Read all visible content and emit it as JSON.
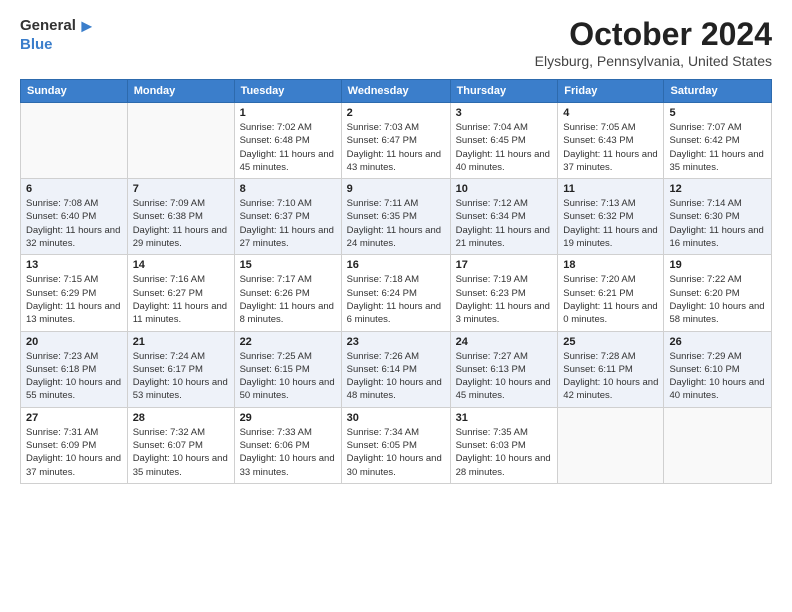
{
  "header": {
    "logo_general": "General",
    "logo_blue": "Blue",
    "month_title": "October 2024",
    "location": "Elysburg, Pennsylvania, United States"
  },
  "columns": [
    "Sunday",
    "Monday",
    "Tuesday",
    "Wednesday",
    "Thursday",
    "Friday",
    "Saturday"
  ],
  "weeks": [
    [
      {
        "day": "",
        "sunrise": "",
        "sunset": "",
        "daylight": ""
      },
      {
        "day": "",
        "sunrise": "",
        "sunset": "",
        "daylight": ""
      },
      {
        "day": "1",
        "sunrise": "Sunrise: 7:02 AM",
        "sunset": "Sunset: 6:48 PM",
        "daylight": "Daylight: 11 hours and 45 minutes."
      },
      {
        "day": "2",
        "sunrise": "Sunrise: 7:03 AM",
        "sunset": "Sunset: 6:47 PM",
        "daylight": "Daylight: 11 hours and 43 minutes."
      },
      {
        "day": "3",
        "sunrise": "Sunrise: 7:04 AM",
        "sunset": "Sunset: 6:45 PM",
        "daylight": "Daylight: 11 hours and 40 minutes."
      },
      {
        "day": "4",
        "sunrise": "Sunrise: 7:05 AM",
        "sunset": "Sunset: 6:43 PM",
        "daylight": "Daylight: 11 hours and 37 minutes."
      },
      {
        "day": "5",
        "sunrise": "Sunrise: 7:07 AM",
        "sunset": "Sunset: 6:42 PM",
        "daylight": "Daylight: 11 hours and 35 minutes."
      }
    ],
    [
      {
        "day": "6",
        "sunrise": "Sunrise: 7:08 AM",
        "sunset": "Sunset: 6:40 PM",
        "daylight": "Daylight: 11 hours and 32 minutes."
      },
      {
        "day": "7",
        "sunrise": "Sunrise: 7:09 AM",
        "sunset": "Sunset: 6:38 PM",
        "daylight": "Daylight: 11 hours and 29 minutes."
      },
      {
        "day": "8",
        "sunrise": "Sunrise: 7:10 AM",
        "sunset": "Sunset: 6:37 PM",
        "daylight": "Daylight: 11 hours and 27 minutes."
      },
      {
        "day": "9",
        "sunrise": "Sunrise: 7:11 AM",
        "sunset": "Sunset: 6:35 PM",
        "daylight": "Daylight: 11 hours and 24 minutes."
      },
      {
        "day": "10",
        "sunrise": "Sunrise: 7:12 AM",
        "sunset": "Sunset: 6:34 PM",
        "daylight": "Daylight: 11 hours and 21 minutes."
      },
      {
        "day": "11",
        "sunrise": "Sunrise: 7:13 AM",
        "sunset": "Sunset: 6:32 PM",
        "daylight": "Daylight: 11 hours and 19 minutes."
      },
      {
        "day": "12",
        "sunrise": "Sunrise: 7:14 AM",
        "sunset": "Sunset: 6:30 PM",
        "daylight": "Daylight: 11 hours and 16 minutes."
      }
    ],
    [
      {
        "day": "13",
        "sunrise": "Sunrise: 7:15 AM",
        "sunset": "Sunset: 6:29 PM",
        "daylight": "Daylight: 11 hours and 13 minutes."
      },
      {
        "day": "14",
        "sunrise": "Sunrise: 7:16 AM",
        "sunset": "Sunset: 6:27 PM",
        "daylight": "Daylight: 11 hours and 11 minutes."
      },
      {
        "day": "15",
        "sunrise": "Sunrise: 7:17 AM",
        "sunset": "Sunset: 6:26 PM",
        "daylight": "Daylight: 11 hours and 8 minutes."
      },
      {
        "day": "16",
        "sunrise": "Sunrise: 7:18 AM",
        "sunset": "Sunset: 6:24 PM",
        "daylight": "Daylight: 11 hours and 6 minutes."
      },
      {
        "day": "17",
        "sunrise": "Sunrise: 7:19 AM",
        "sunset": "Sunset: 6:23 PM",
        "daylight": "Daylight: 11 hours and 3 minutes."
      },
      {
        "day": "18",
        "sunrise": "Sunrise: 7:20 AM",
        "sunset": "Sunset: 6:21 PM",
        "daylight": "Daylight: 11 hours and 0 minutes."
      },
      {
        "day": "19",
        "sunrise": "Sunrise: 7:22 AM",
        "sunset": "Sunset: 6:20 PM",
        "daylight": "Daylight: 10 hours and 58 minutes."
      }
    ],
    [
      {
        "day": "20",
        "sunrise": "Sunrise: 7:23 AM",
        "sunset": "Sunset: 6:18 PM",
        "daylight": "Daylight: 10 hours and 55 minutes."
      },
      {
        "day": "21",
        "sunrise": "Sunrise: 7:24 AM",
        "sunset": "Sunset: 6:17 PM",
        "daylight": "Daylight: 10 hours and 53 minutes."
      },
      {
        "day": "22",
        "sunrise": "Sunrise: 7:25 AM",
        "sunset": "Sunset: 6:15 PM",
        "daylight": "Daylight: 10 hours and 50 minutes."
      },
      {
        "day": "23",
        "sunrise": "Sunrise: 7:26 AM",
        "sunset": "Sunset: 6:14 PM",
        "daylight": "Daylight: 10 hours and 48 minutes."
      },
      {
        "day": "24",
        "sunrise": "Sunrise: 7:27 AM",
        "sunset": "Sunset: 6:13 PM",
        "daylight": "Daylight: 10 hours and 45 minutes."
      },
      {
        "day": "25",
        "sunrise": "Sunrise: 7:28 AM",
        "sunset": "Sunset: 6:11 PM",
        "daylight": "Daylight: 10 hours and 42 minutes."
      },
      {
        "day": "26",
        "sunrise": "Sunrise: 7:29 AM",
        "sunset": "Sunset: 6:10 PM",
        "daylight": "Daylight: 10 hours and 40 minutes."
      }
    ],
    [
      {
        "day": "27",
        "sunrise": "Sunrise: 7:31 AM",
        "sunset": "Sunset: 6:09 PM",
        "daylight": "Daylight: 10 hours and 37 minutes."
      },
      {
        "day": "28",
        "sunrise": "Sunrise: 7:32 AM",
        "sunset": "Sunset: 6:07 PM",
        "daylight": "Daylight: 10 hours and 35 minutes."
      },
      {
        "day": "29",
        "sunrise": "Sunrise: 7:33 AM",
        "sunset": "Sunset: 6:06 PM",
        "daylight": "Daylight: 10 hours and 33 minutes."
      },
      {
        "day": "30",
        "sunrise": "Sunrise: 7:34 AM",
        "sunset": "Sunset: 6:05 PM",
        "daylight": "Daylight: 10 hours and 30 minutes."
      },
      {
        "day": "31",
        "sunrise": "Sunrise: 7:35 AM",
        "sunset": "Sunset: 6:03 PM",
        "daylight": "Daylight: 10 hours and 28 minutes."
      },
      {
        "day": "",
        "sunrise": "",
        "sunset": "",
        "daylight": ""
      },
      {
        "day": "",
        "sunrise": "",
        "sunset": "",
        "daylight": ""
      }
    ]
  ]
}
